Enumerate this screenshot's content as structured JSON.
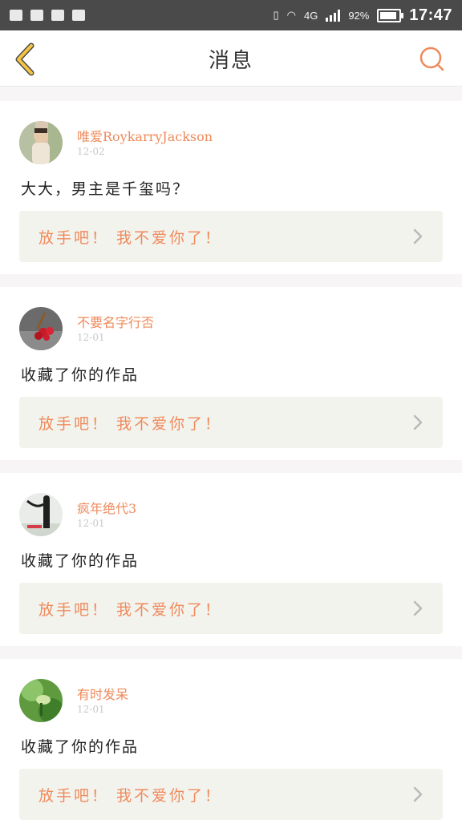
{
  "status_bar": {
    "network": "4G",
    "battery_percent": "92%",
    "battery_level": 0.92,
    "time": "17:47"
  },
  "header": {
    "title": "消息"
  },
  "messages": [
    {
      "username": "唯爱RoykarryJackson",
      "date": "12-02",
      "text": "大大，男主是千玺吗？",
      "quote": "放手吧！ 我不爱你了！"
    },
    {
      "username": "不要名字行否",
      "date": "12-01",
      "text": "收藏了你的作品",
      "quote": "放手吧！ 我不爱你了！"
    },
    {
      "username": "疯年绝代3",
      "date": "12-01",
      "text": "收藏了你的作品",
      "quote": "放手吧！ 我不爱你了！"
    },
    {
      "username": "有时发呆",
      "date": "12-01",
      "text": "收藏了你的作品",
      "quote": "放手吧！ 我不爱你了！"
    }
  ],
  "colors": {
    "accent": "#ef8a5b",
    "back_arrow": "#f4c542",
    "quote_bg": "#f3f3ee",
    "page_bg": "#f7f5f6"
  },
  "icons": {
    "back": "chevron-left-icon",
    "search": "search-icon",
    "quote_chevron": "chevron-right-icon"
  }
}
